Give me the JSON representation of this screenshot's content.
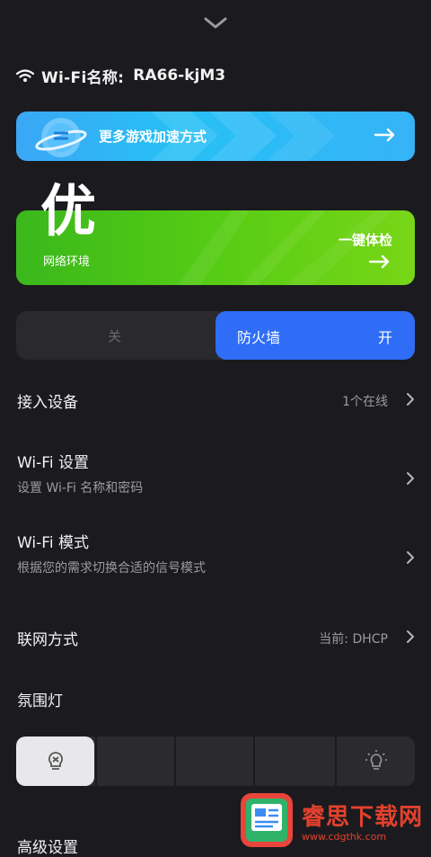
{
  "wifi": {
    "label": "Wi-Fi名称:",
    "ssid": "RA66-kjM3"
  },
  "game_banner": {
    "label": "更多游戏加速方式"
  },
  "network": {
    "grade": "优",
    "label": "网络环境",
    "action": "一键体检"
  },
  "firewall": {
    "off_label": "关",
    "name": "防火墙",
    "state": "开"
  },
  "rows": {
    "devices": {
      "title": "接入设备",
      "value": "1个在线"
    },
    "wifi_settings": {
      "title": "Wi-Fi 设置",
      "subtitle": "设置 Wi-Fi 名称和密码"
    },
    "wifi_mode": {
      "title": "Wi-Fi 模式",
      "subtitle": "根据您的需求切换合适的信号模式"
    },
    "connection": {
      "title": "联网方式",
      "value": "当前: DHCP"
    },
    "ambient_light": {
      "title": "氛围灯"
    },
    "advanced": {
      "title": "高级设置"
    }
  },
  "watermark": {
    "text": "睿思下载网",
    "url": "www.cdgthk.com"
  },
  "colors": {
    "background": "#1b1b1f",
    "blue_banner": "#27c0f5",
    "green_banner": "#56cc14",
    "toggle_active": "#2f6df6",
    "watermark": "#e2412e"
  },
  "icons": [
    "chevron-down-icon",
    "wifi-icon",
    "arrow-right-icon",
    "chevron-right-icon",
    "bulb-off-icon",
    "bulb-on-icon"
  ]
}
